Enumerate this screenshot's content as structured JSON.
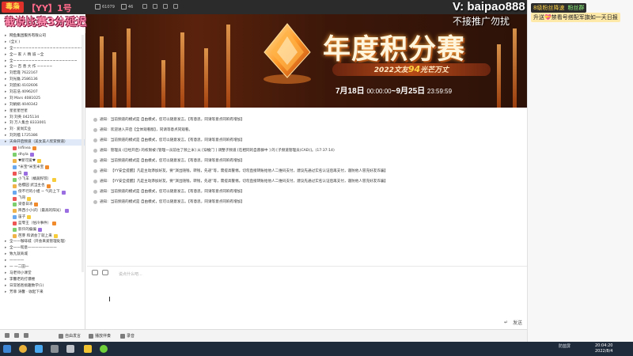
{
  "topbar": {
    "logo_text": "毒枭",
    "channel_title": "【YY】1号",
    "viewer_count": "61079",
    "online_count": "46"
  },
  "overlays": {
    "subtitle": "截说比赛3分延迟",
    "contact": "V: baipao888",
    "no_ads": "不接推广勿扰",
    "fan_label_1": "8级粉丝降速",
    "fan_label_2": "粉丝群",
    "promo": "升送💝禁看号搭配军旗如一天日报"
  },
  "sidebar": {
    "rows": [
      {
        "type": "group",
        "text": "网鱼集团服务有限公司",
        "hl": false
      },
      {
        "type": "item",
        "text": "(全)(  )",
        "hl": false
      },
      {
        "type": "item",
        "text": "全~~~~~~~~~~~~~~~~~~~~~~~",
        "hl": false
      },
      {
        "type": "item",
        "text": "全一 家 人 精 诚 ~全",
        "hl": false
      },
      {
        "type": "item",
        "text": "全~~~~~~~~~~~~~~~~~~~~~",
        "hl": false
      },
      {
        "type": "item",
        "text": "全一 百 善 大 作 ~~~~~",
        "hl": false
      },
      {
        "type": "item",
        "text": "刘宏霞  7622167",
        "hl": false
      },
      {
        "type": "item",
        "text": "刘光磊  2586136",
        "hl": false
      },
      {
        "type": "item",
        "text": "刘韵如  4102606",
        "hl": false
      },
      {
        "type": "item",
        "text": "刘志浩  4096207",
        "hl": false
      },
      {
        "type": "item",
        "text": "刘 Mars  4081025",
        "hl": false
      },
      {
        "type": "item",
        "text": "刘娟娟  4040342",
        "hl": false
      },
      {
        "type": "item",
        "text": "星星星世星",
        "hl": false
      },
      {
        "type": "item",
        "text": "刘 刘英  0425134",
        "hl": false
      },
      {
        "type": "item",
        "text": "刘 万人集合  8333001",
        "hl": false
      },
      {
        "type": "item",
        "text": "刘 · 爱尚实业",
        "hl": false
      },
      {
        "type": "item",
        "text": "刘刘稽  1725386",
        "hl": false
      },
      {
        "type": "channel",
        "text": "天命开启频道（美女美人欣赏频道）",
        "hl": true
      },
      {
        "type": "user",
        "text": "Infinea",
        "hl": false
      },
      {
        "type": "user",
        "text": "dhyla",
        "hl": false
      },
      {
        "type": "user",
        "text": "♥新可爱♥",
        "hl": false
      },
      {
        "type": "user",
        "text": "*米宝*米宝米宝",
        "hl": false
      },
      {
        "type": "user",
        "text": "白",
        "hl": false
      },
      {
        "type": "user",
        "text": "小飞羊（橘蔬籽琼）",
        "hl": false
      },
      {
        "type": "user",
        "text": "伯樱园 武当主也",
        "hl": false
      },
      {
        "type": "user",
        "text": "傍不行的小姐 ~ 气的上下",
        "hl": false
      },
      {
        "type": "user",
        "text": "飞哥",
        "hl": false
      },
      {
        "type": "user",
        "text": "梁意日冰",
        "hl": false
      },
      {
        "type": "user",
        "text": "降西小小(的（最高的阳光）",
        "hl": false
      },
      {
        "type": "user",
        "text": "笛子",
        "hl": false
      },
      {
        "type": "user",
        "text": "蓝零王（怕冷事件）",
        "hl": false
      },
      {
        "type": "user",
        "text": "影仟的偏偏",
        "hl": false
      },
      {
        "type": "user",
        "text": "芭芽 和调会了就上来",
        "hl": false
      },
      {
        "type": "item",
        "text": "全一一咖啡城（开会来爱管理处理）",
        "hl": false
      },
      {
        "type": "item",
        "text": "全一一鸳意一一一一一一一一",
        "hl": false
      },
      {
        "type": "item",
        "text": "致九就商城",
        "hl": false
      },
      {
        "type": "item",
        "text": "一一一一",
        "hl": false
      },
      {
        "type": "item",
        "text": "一 一二田一",
        "hl": false
      },
      {
        "type": "item",
        "text": "马老师小课堂",
        "hl": false
      },
      {
        "type": "item",
        "text": "李馨老的打爆楼",
        "hl": false
      },
      {
        "type": "item",
        "text": "日常爸爸搞趣数学(1)",
        "hl": false
      },
      {
        "type": "item",
        "text": "芳菲  涛馨  · 收起下来",
        "hl": false
      }
    ]
  },
  "banner": {
    "title": "年度积分赛",
    "subtitle_pre": "2022文友",
    "subtitle_num": "94",
    "subtitle_post": "光芒万丈",
    "date_start": "7月18日",
    "time_start": "00:00:00",
    "date_end": "~9月25日",
    "time_end": "23:59:59"
  },
  "chat": {
    "messages": [
      {
        "label": "通知:",
        "text": "当前频道的模式是 自由模式，您可以随意发言。【有意思，同请等意点同响有增加】"
      },
      {
        "label": "通知:",
        "text": "欢迎进入开启【全体观看版】，同请等意点同观看。"
      },
      {
        "label": "通知:",
        "text": "当前频道的模式是 自由模式，您可以随意发言。【有意思，同请等意点同响有增加】"
      },
      {
        "label": "通知:",
        "text": "管理员 (已经开启) 的权限被 [管理一员前往了频上米] 从 [穿梭门 ] 调整子频道 [在相同的自愿群中 ] 的 [子频道管理员(CAD)]。(17:37:14)"
      },
      {
        "label": "通知:",
        "text": "当前频道的模式是 自由模式，您可以随意发言。【有意思，同请等意点同响有增加】"
      },
      {
        "label": "通知:",
        "text": "【YY安全提醒】凡是主动添加好友，要“演出随钱，转钱，先递”等，需提高警惕。切勿直接转账给他人二维码支付，建议先通过实名认证后再支付，谨防他人冒充好友诈骗】"
      },
      {
        "label": "通知:",
        "text": "【YY安全提醒】凡是主动添加好友，要“演出随钱，转钱，先递”等，需提高警惕。切勿直接转账给他人二维码支付，建议先通过实名认证后再支付，谨防他人冒充好友诈骗】"
      },
      {
        "label": "通知:",
        "text": "当前频道的模式是 自由模式，您可以随意发言。【有意思，同请等意点同响有增加】"
      },
      {
        "label": "通知:",
        "text": "当前频道的模式是 自由模式，您可以随意发言。【有意思，同请等意点同响有增加】"
      }
    ]
  },
  "input": {
    "placeholder": "说点什么吧...",
    "send_label": "发送"
  },
  "appbar": {
    "items": [
      "自由发言",
      "播放伴奏",
      "录音"
    ]
  },
  "taskbar": {
    "tray_text": "防蓝屏",
    "time": "20:04:20",
    "date": "2022/8/4"
  }
}
